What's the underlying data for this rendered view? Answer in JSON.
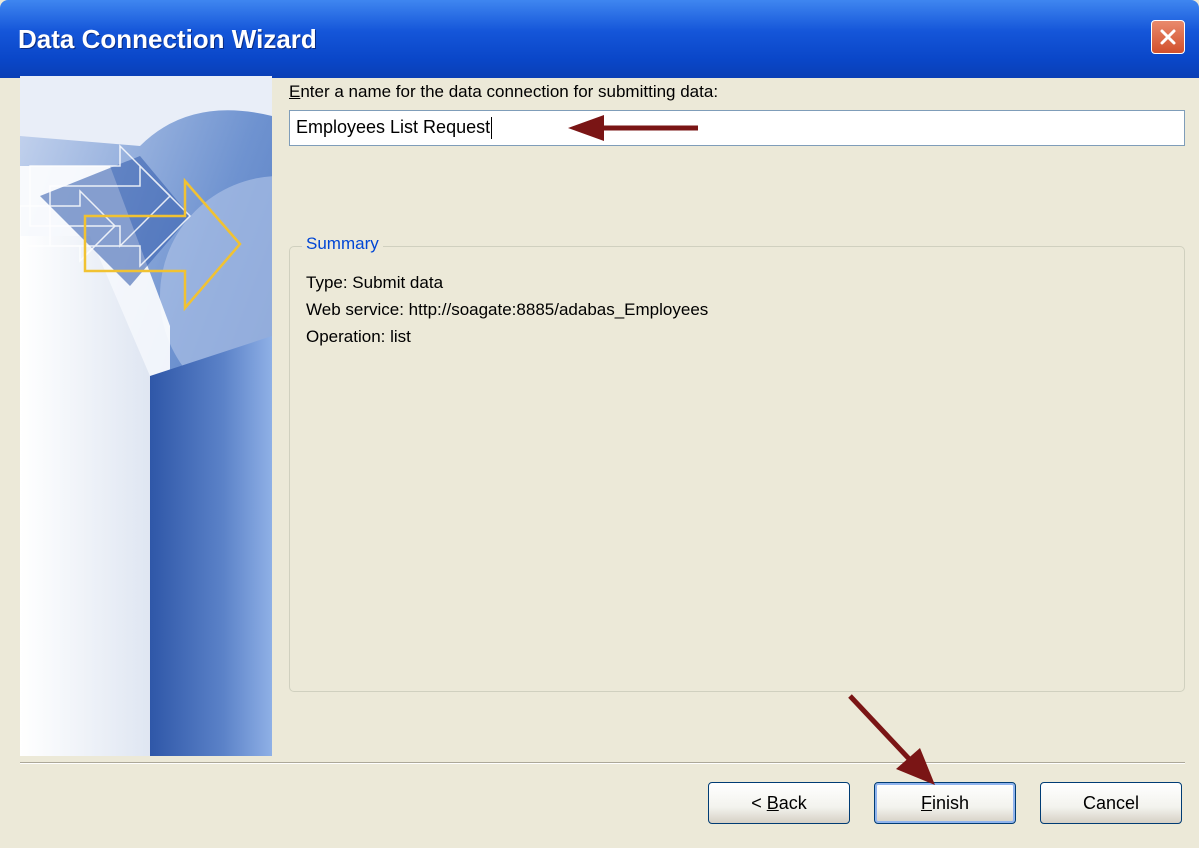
{
  "window": {
    "title": "Data Connection Wizard",
    "close_icon": "close-icon"
  },
  "form": {
    "name_label": "Enter a name for the data connection for submitting data:",
    "name_value": "Employees List Request"
  },
  "summary": {
    "legend": "Summary",
    "lines": [
      "Type: Submit data",
      "Web service: http://soagate:8885/adabas_Employees",
      "Operation: list"
    ]
  },
  "buttons": {
    "back_prefix": "< ",
    "back_mnemonic": "B",
    "back_rest": "ack",
    "finish_mnemonic": "F",
    "finish_rest": "inish",
    "cancel": "Cancel"
  },
  "colors": {
    "accent": "#0a47c9",
    "annotation_arrow": "#7a1515",
    "legend_text": "#0046d5"
  }
}
